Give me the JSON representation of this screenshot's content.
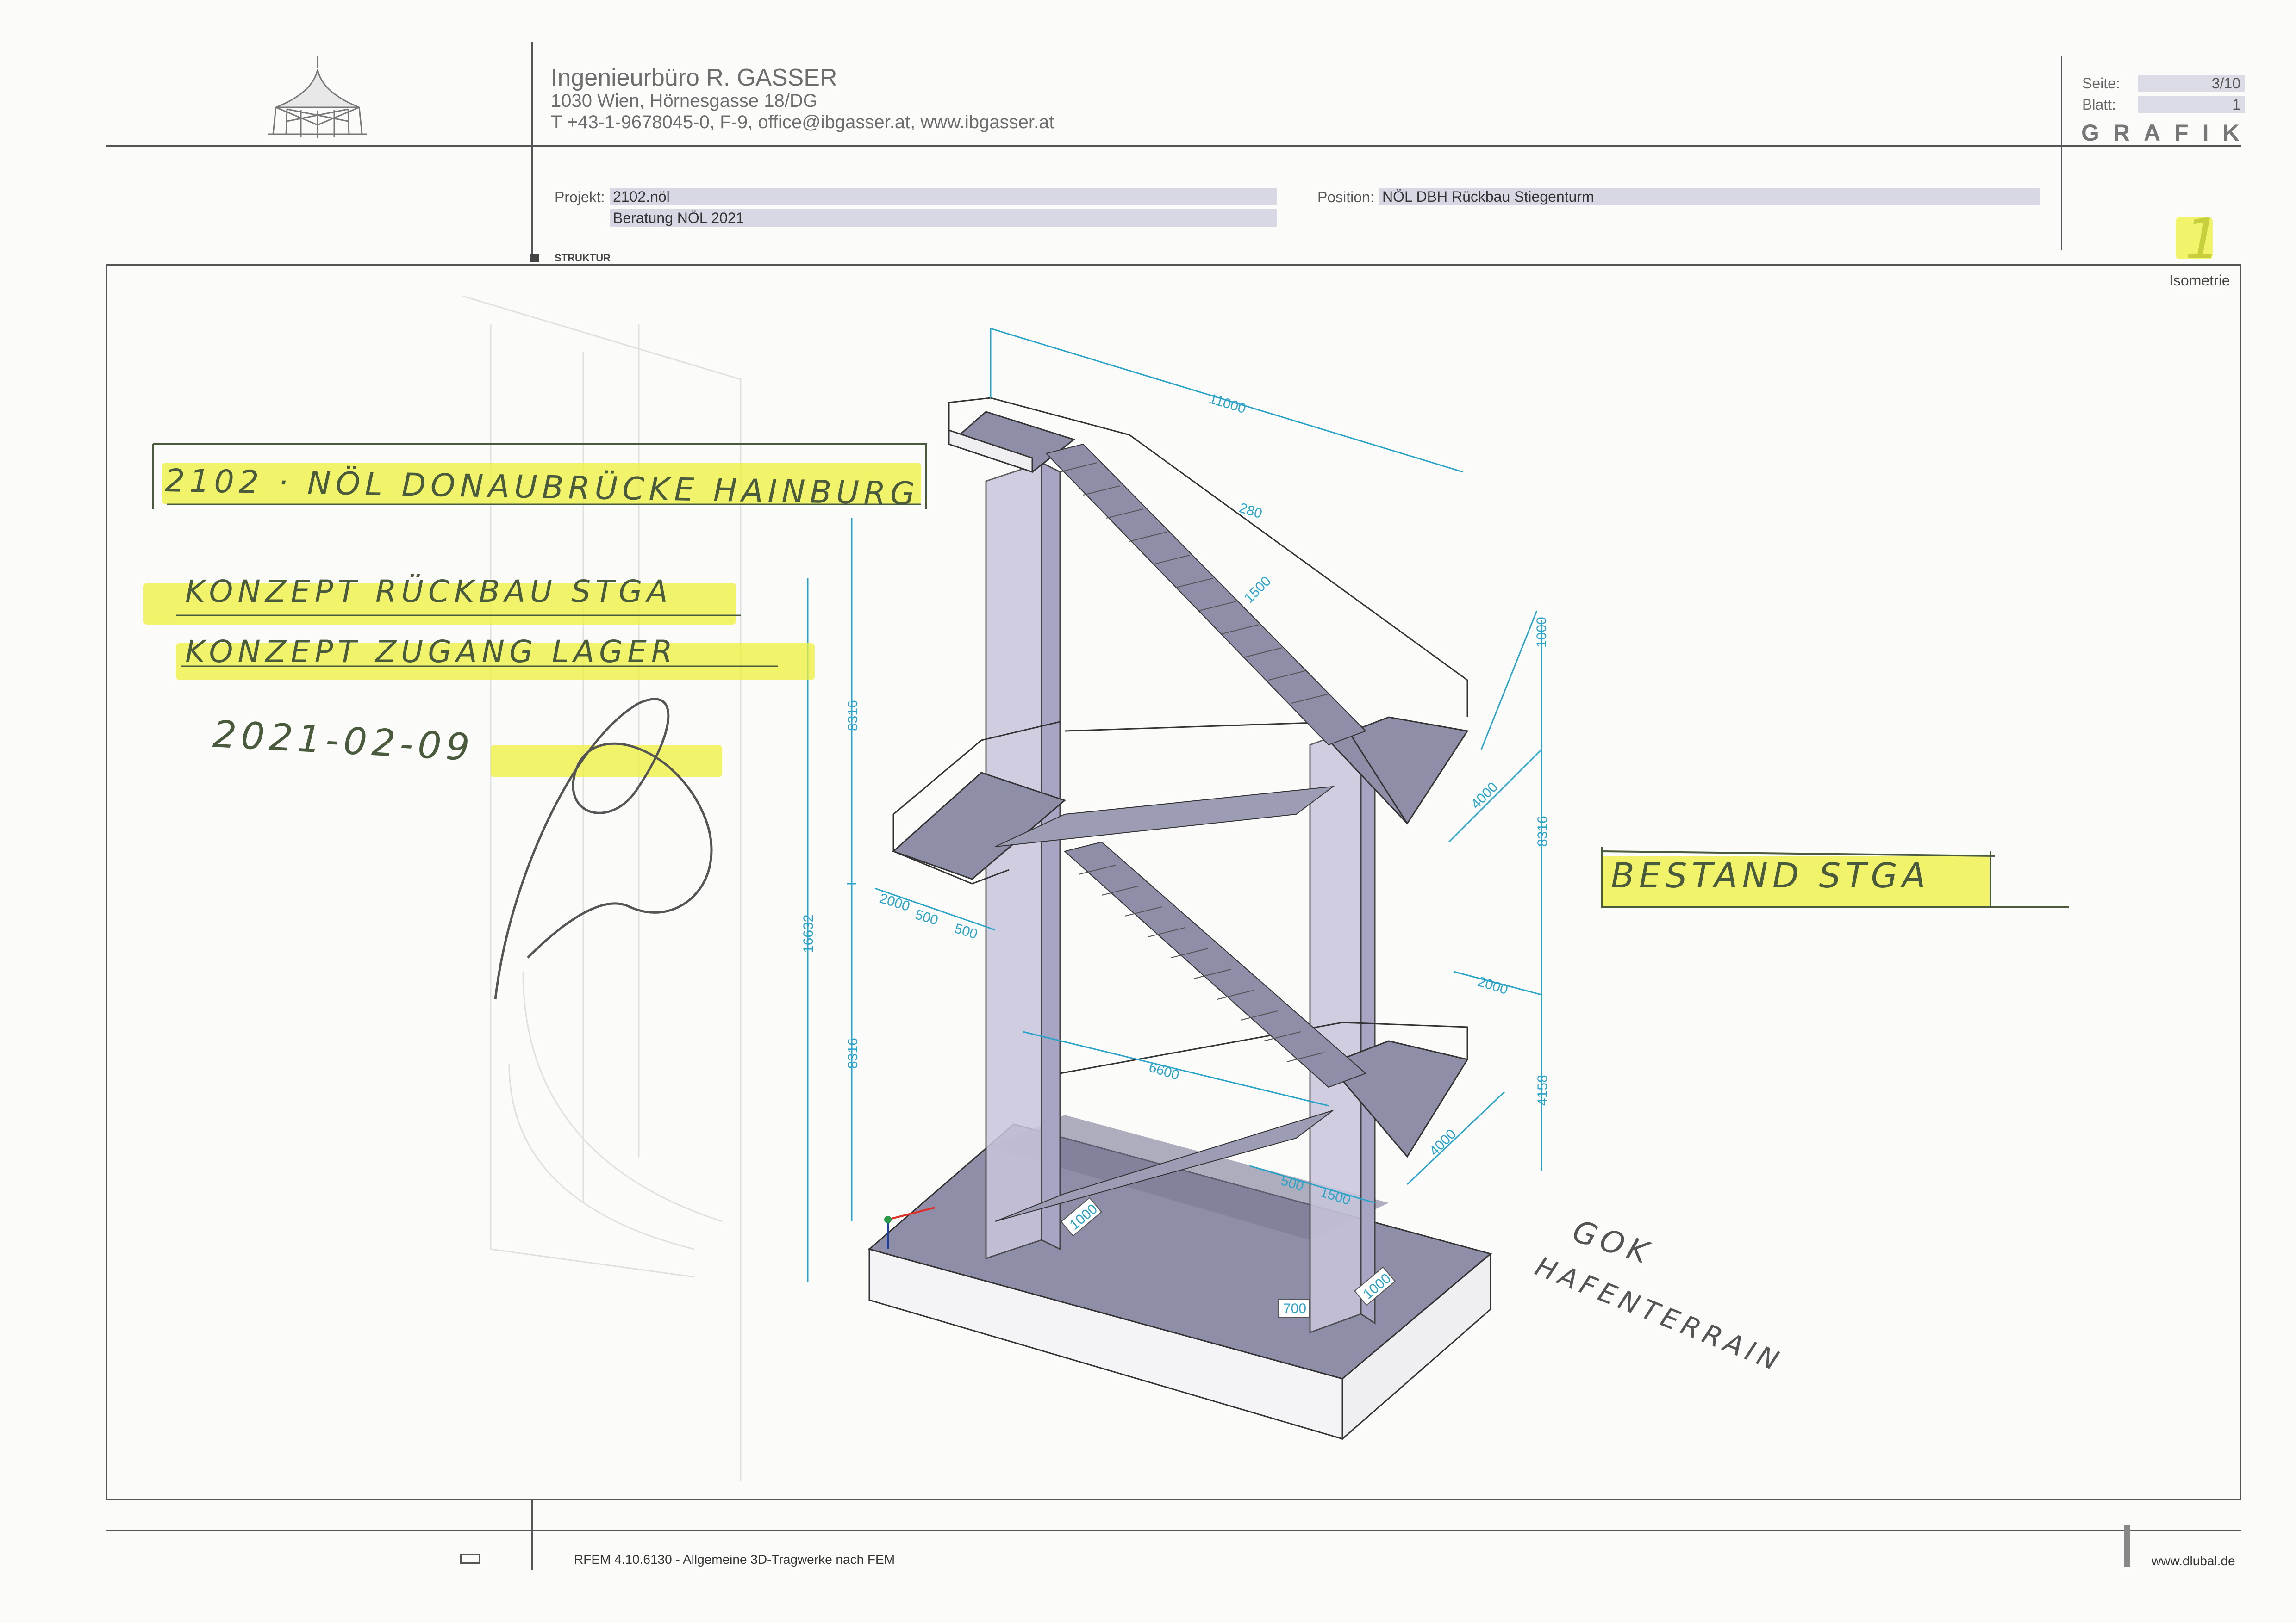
{
  "header": {
    "company_name": "Ingenieurbüro R. GASSER",
    "company_address": "1030 Wien, Hörnesgasse 18/DG",
    "company_contact": "T +43-1-9678045-0,  F-9,  office@ibgasser.at,  www.ibgasser.at",
    "seite_label": "Seite:",
    "seite_value": "3/10",
    "blatt_label": "Blatt:",
    "blatt_value": "1",
    "section": "GRAFIK",
    "projekt_label": "Projekt:",
    "projekt_value": "2102.nöl",
    "projekt_sub": "Beratung NÖL 2021",
    "position_label": "Position:",
    "position_value": "NÖL DBH Rückbau Stiegenturm",
    "struktur_label": "STRUKTUR"
  },
  "view": {
    "number": "1",
    "name": "Isometrie"
  },
  "annotations": {
    "line1": "2102 · NÖL DONAUBRÜCKE HAINBURG",
    "line2": "KONZEPT RÜCKBAU STGA",
    "line3": "KONZEPT ZUGANG LAGER",
    "date": "2021-02-09",
    "right_note": "BESTAND STGA",
    "gok_note": "GOK",
    "gok_note2": "HAFENTERRAIN"
  },
  "dimensions": {
    "d11000": "11000",
    "d280": "280",
    "d1500a": "1500",
    "d1000a": "1000",
    "d4000a": "4000",
    "d8316a": "8316",
    "d8316b": "8316",
    "d8316c": "8316",
    "d16632": "16632",
    "d2000a": "2000",
    "d500a": "500",
    "d500b": "500",
    "d2000b": "2000",
    "d6600": "6600",
    "d4158": "4158",
    "d4000b": "4000",
    "d500c": "500",
    "d1500b": "1500",
    "d1000b": "1000",
    "d1000c": "1000",
    "d700": "700"
  },
  "footer": {
    "software": "RFEM 4.10.6130 - Allgemeine 3D-Tragwerke nach FEM",
    "url": "www.dlubal.de"
  },
  "colors": {
    "dimension": "#2aa3c8",
    "highlight": "#eef23a",
    "slab_fill": "#8e8ea8",
    "column_fill": "#c9c6dc"
  }
}
